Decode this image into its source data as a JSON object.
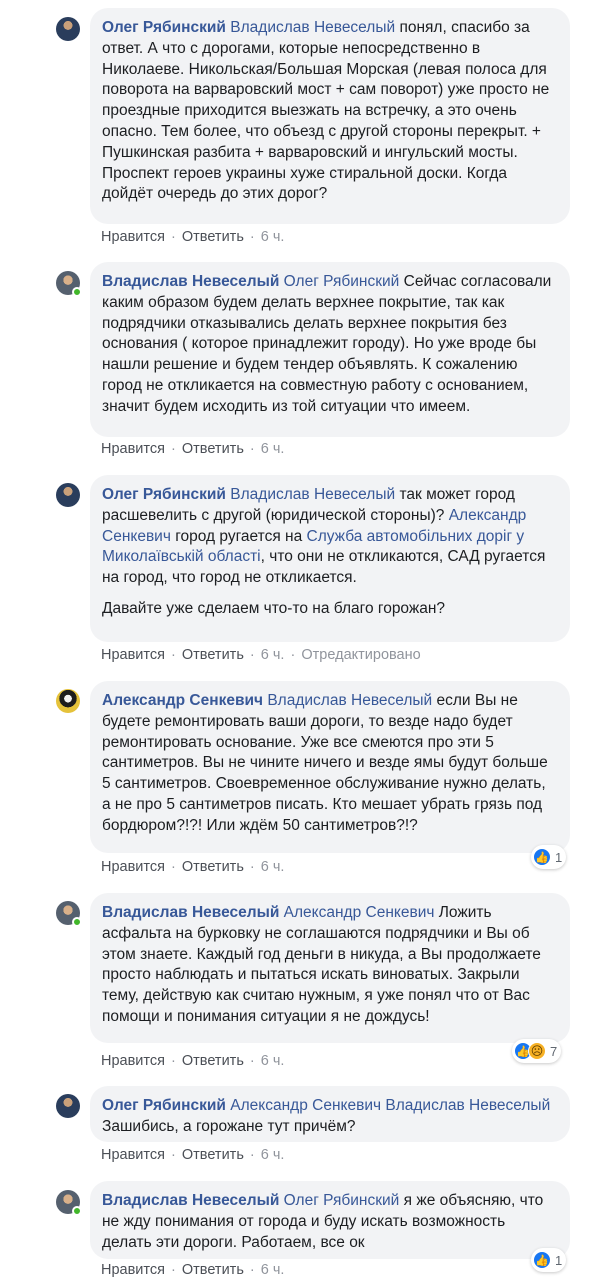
{
  "actions": {
    "like": "Нравится",
    "reply": "Ответить",
    "separator": "·",
    "time": "6 ч.",
    "edited": "Отредактировано"
  },
  "comments": [
    {
      "author": "Олег Рябинский",
      "mention": "Владислав Невеселый",
      "text": " понял, спасибо за ответ. А что с дорогами, которые непосредственно в Николаеве. Никольская/Большая Морская (левая полоса для поворота на варваровский мост + сам поворот) уже просто не проездные приходится выезжать на встречку, а это очень опасно. Тем более, что объезд с другой стороны перекрыт. + Пушкинская разбита + варваровский и ингульский мосты. Проспект героев украины хуже стиральной доски. Когда дойдёт очередь до этих дорог?"
    },
    {
      "author": "Владислав Невеселый",
      "mention": "Олег Рябинский",
      "text": " Сейчас согласовали каким образом будем делать верхнее покрытие, так как подрядчики отказывались делать верхнее покрытия без основания ( которое принадлежит городу). Но уже вроде бы нашли решение и будем тендер объявлять. К сожалению город не откликается на совместную работу с основанием, значит будем исходить из той ситуации что имеем."
    },
    {
      "author": "Олег Рябинский",
      "mention": "Владислав Невеселый",
      "text": " так может город расшевелить с другой (юридической стороны)?",
      "mention2": "Александр Сенкевич",
      "text2": " город ругается на ",
      "mention3": "Служба автомобільних доріг у Миколаївській області",
      "text3": ", что они не откликаются, САД ругается на город, что город не откликается.",
      "para2": "Давайте уже сделаем что-то на благо горожан?"
    },
    {
      "author": "Александр Сенкевич",
      "mention": "Владислав Невеселый",
      "text": " если Вы не будете ремонтировать ваши дороги, то везде надо будет ремонтировать основание. Уже все смеются про эти 5 сантиметров. Вы не чините ничего и везде ямы будут больше 5 сантиметров. Своевременное обслуживание нужно делать, а не про 5 сантиметров писать. Кто мешает убрать грязь под бордюром?!?! Или ждём 50 сантиметров?!?",
      "reactions": "1"
    },
    {
      "author": "Владислав Невеселый",
      "mention": "Александр Сенкевич",
      "text": " Ложить асфальта на бурковку не соглашаются подрядчики и Вы об этом знаете. Каждый год деньги в никуда, а Вы продолжаете просто наблюдать и пытаться искать виноватых. Закрыли тему, действую как считаю нужным, я уже понял что от Вас помощи и понимания ситуации я не дождусь!",
      "reactions": "7"
    },
    {
      "author": "Олег Рябинский",
      "mention": "Александр Сенкевич",
      "mention2": "Владислав Невеселый",
      "text": " Зашибись, а горожане тут причём?"
    },
    {
      "author": "Владислав Невеселый",
      "mention": "Олег Рябинский",
      "text": " я же объясняю, что не жду понимания от города и буду искать возможность делать эти дороги. Работаем, все ок",
      "reactions": "1"
    }
  ],
  "icons": {
    "like": "like-icon",
    "sad": "sad-icon"
  },
  "colors": {
    "name": "#385898",
    "bubble": "#f2f3f5",
    "like": "#1877f2",
    "online": "#42b72a"
  }
}
